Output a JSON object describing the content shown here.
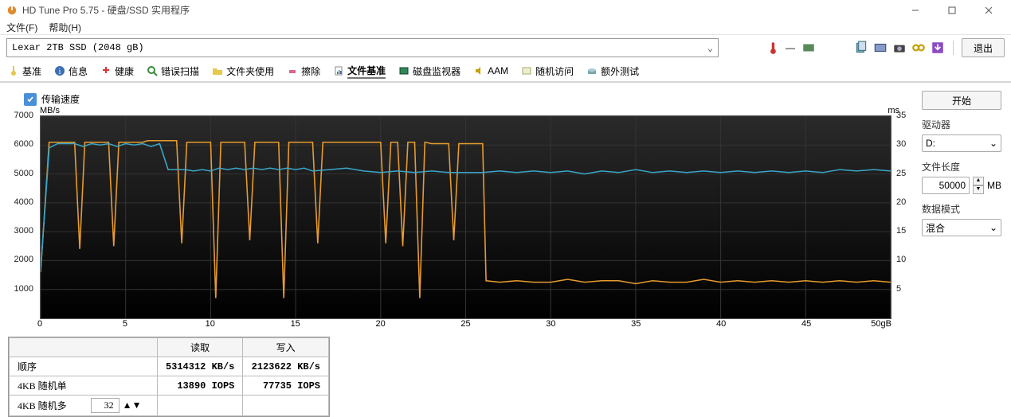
{
  "window": {
    "title": "HD Tune Pro 5.75 - 硬盘/SSD 实用程序"
  },
  "menu": {
    "file": "文件(F)",
    "help": "帮助(H)"
  },
  "drive": {
    "selected": "Lexar 2TB SSD (2048 gB)"
  },
  "temp_display": "—",
  "exit_button": "退出",
  "tabs": {
    "benchmark": "基准",
    "info": "信息",
    "health": "健康",
    "errorscan": "错误扫描",
    "folderusage": "文件夹使用",
    "erase": "擦除",
    "filebench": "文件基准",
    "diskmonitor": "磁盘监视器",
    "aam": "AAM",
    "randomaccess": "随机访问",
    "extra": "额外测试"
  },
  "chk_label": "传输速度",
  "chart_data": {
    "type": "line",
    "x_unit": "gB",
    "xlim": [
      0,
      50
    ],
    "y1_label": "MB/s",
    "y1_lim": [
      0,
      7000
    ],
    "y2_label": "ms",
    "y2_lim": [
      0,
      35
    ],
    "x_ticks": [
      0,
      5,
      10,
      15,
      20,
      25,
      30,
      35,
      40,
      45,
      50
    ],
    "y1_ticks": [
      1000,
      2000,
      3000,
      4000,
      5000,
      6000,
      7000
    ],
    "y2_ticks": [
      5,
      10,
      15,
      20,
      25,
      30,
      35
    ],
    "series": [
      {
        "name": "写入 (MB/s)",
        "axis": "y1",
        "color": "#e69b2e",
        "points": [
          [
            0,
            1600
          ],
          [
            0.5,
            6100
          ],
          [
            1,
            6100
          ],
          [
            1.5,
            6100
          ],
          [
            2,
            6100
          ],
          [
            2.3,
            2400
          ],
          [
            2.6,
            6100
          ],
          [
            3,
            6100
          ],
          [
            3.5,
            6100
          ],
          [
            4,
            6100
          ],
          [
            4.3,
            2500
          ],
          [
            4.6,
            6100
          ],
          [
            5,
            6100
          ],
          [
            5.5,
            6100
          ],
          [
            6,
            6100
          ],
          [
            6.3,
            6150
          ],
          [
            7,
            6150
          ],
          [
            7.5,
            6150
          ],
          [
            8,
            6150
          ],
          [
            8.3,
            2600
          ],
          [
            8.6,
            6100
          ],
          [
            9,
            6100
          ],
          [
            9.5,
            6100
          ],
          [
            10,
            6100
          ],
          [
            10.3,
            700
          ],
          [
            10.6,
            6100
          ],
          [
            11,
            6100
          ],
          [
            11.5,
            6100
          ],
          [
            12,
            6100
          ],
          [
            12.3,
            2700
          ],
          [
            12.6,
            6100
          ],
          [
            13,
            6100
          ],
          [
            13.5,
            6100
          ],
          [
            14,
            6100
          ],
          [
            14.3,
            700
          ],
          [
            14.6,
            6100
          ],
          [
            15,
            6100
          ],
          [
            15.5,
            6100
          ],
          [
            16,
            6100
          ],
          [
            16.3,
            2600
          ],
          [
            16.6,
            6100
          ],
          [
            17,
            6100
          ],
          [
            17.5,
            6100
          ],
          [
            18,
            6100
          ],
          [
            19,
            6100
          ],
          [
            20,
            6100
          ],
          [
            20.3,
            2600
          ],
          [
            20.6,
            6100
          ],
          [
            21,
            6100
          ],
          [
            21.3,
            2500
          ],
          [
            21.6,
            6100
          ],
          [
            22,
            6100
          ],
          [
            22.3,
            700
          ],
          [
            22.6,
            6100
          ],
          [
            23,
            6050
          ],
          [
            23.5,
            6050
          ],
          [
            24,
            6050
          ],
          [
            24.3,
            2700
          ],
          [
            24.6,
            6050
          ],
          [
            25,
            6050
          ],
          [
            25.5,
            6050
          ],
          [
            26,
            6050
          ],
          [
            26.2,
            1300
          ],
          [
            27,
            1250
          ],
          [
            28,
            1300
          ],
          [
            29,
            1250
          ],
          [
            30,
            1250
          ],
          [
            31,
            1350
          ],
          [
            32,
            1250
          ],
          [
            33,
            1300
          ],
          [
            34,
            1300
          ],
          [
            35,
            1200
          ],
          [
            36,
            1300
          ],
          [
            37,
            1250
          ],
          [
            38,
            1250
          ],
          [
            39,
            1350
          ],
          [
            40,
            1250
          ],
          [
            41,
            1300
          ],
          [
            42,
            1250
          ],
          [
            43,
            1300
          ],
          [
            44,
            1250
          ],
          [
            45,
            1300
          ],
          [
            46,
            1250
          ],
          [
            47,
            1300
          ],
          [
            48,
            1250
          ],
          [
            49,
            1300
          ],
          [
            50,
            1250
          ]
        ]
      },
      {
        "name": "读取 (MB/s)",
        "axis": "y1",
        "color": "#3aa6c9",
        "points": [
          [
            0,
            1650
          ],
          [
            0.5,
            5900
          ],
          [
            1,
            6050
          ],
          [
            1.5,
            6050
          ],
          [
            2,
            6050
          ],
          [
            2.5,
            5950
          ],
          [
            3,
            6050
          ],
          [
            3.5,
            6000
          ],
          [
            4,
            6050
          ],
          [
            4.5,
            5950
          ],
          [
            5,
            6050
          ],
          [
            5.5,
            6000
          ],
          [
            6,
            6050
          ],
          [
            6.5,
            5950
          ],
          [
            7,
            6050
          ],
          [
            7.5,
            5150
          ],
          [
            8,
            5150
          ],
          [
            8.5,
            5150
          ],
          [
            9,
            5100
          ],
          [
            9.5,
            5150
          ],
          [
            10,
            5100
          ],
          [
            10.5,
            5200
          ],
          [
            11,
            5150
          ],
          [
            11.5,
            5200
          ],
          [
            12,
            5150
          ],
          [
            12.5,
            5200
          ],
          [
            13,
            5150
          ],
          [
            13.5,
            5200
          ],
          [
            14,
            5150
          ],
          [
            14.5,
            5200
          ],
          [
            15,
            5150
          ],
          [
            15.5,
            5200
          ],
          [
            16,
            5100
          ],
          [
            17,
            5150
          ],
          [
            18,
            5200
          ],
          [
            19,
            5100
          ],
          [
            20,
            5050
          ],
          [
            21,
            5100
          ],
          [
            22,
            5050
          ],
          [
            23,
            5100
          ],
          [
            24,
            5050
          ],
          [
            25,
            5050
          ],
          [
            26,
            5050
          ],
          [
            27,
            5100
          ],
          [
            28,
            5050
          ],
          [
            29,
            5100
          ],
          [
            30,
            5050
          ],
          [
            31,
            5100
          ],
          [
            32,
            5000
          ],
          [
            33,
            5100
          ],
          [
            34,
            5050
          ],
          [
            35,
            5150
          ],
          [
            36,
            5050
          ],
          [
            37,
            5100
          ],
          [
            38,
            5050
          ],
          [
            39,
            5100
          ],
          [
            40,
            5050
          ],
          [
            41,
            5100
          ],
          [
            42,
            5050
          ],
          [
            43,
            5100
          ],
          [
            44,
            5050
          ],
          [
            45,
            5100
          ],
          [
            46,
            5050
          ],
          [
            47,
            5150
          ],
          [
            48,
            5100
          ],
          [
            49,
            5150
          ],
          [
            50,
            5100
          ]
        ]
      }
    ]
  },
  "results": {
    "headers": {
      "col0": "",
      "read": "读取",
      "write": "写入"
    },
    "rows": [
      {
        "label": "顺序",
        "read": "5314312 KB/s",
        "write": "2123622 KB/s"
      },
      {
        "label": "4KB 随机单",
        "read": "13890 IOPS",
        "write": "77735 IOPS"
      },
      {
        "label": "4KB 随机多",
        "threads": "32",
        "read": "",
        "write": ""
      }
    ]
  },
  "side": {
    "start": "开始",
    "drive_label": "驱动器",
    "drive_value": "D:",
    "file_len_label": "文件长度",
    "file_len_value": "50000",
    "file_len_unit": "MB",
    "mode_label": "数据模式",
    "mode_value": "混合"
  }
}
